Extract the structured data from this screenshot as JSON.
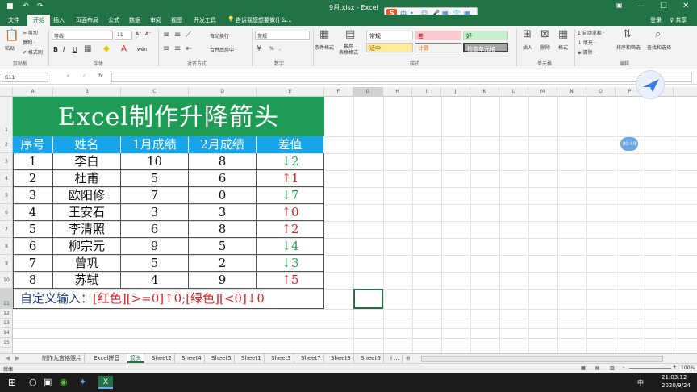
{
  "window": {
    "title": "9月.xlsx - Excel",
    "min": "—",
    "max": "☐",
    "close": "✕",
    "restore": "▣"
  },
  "quick_access": {
    "save": "■",
    "undo": "↶",
    "redo": "↷"
  },
  "ime": {
    "logo": "S",
    "items": [
      "中",
      "•,",
      "☺",
      "🎤",
      "▦",
      "👕",
      "▦"
    ]
  },
  "tabs": [
    "文件",
    "开始",
    "插入",
    "页面布局",
    "公式",
    "数据",
    "审阅",
    "视图",
    "开发工具"
  ],
  "active_tab": "开始",
  "tellme": "告诉我您想要做什么...",
  "account": {
    "login": "登录",
    "share": "♀ 共享"
  },
  "ribbon": {
    "clipboard": {
      "paste": "粘贴",
      "cut": "✂ 剪切",
      "copy": "复制 ·",
      "painter": "✐ 格式刷",
      "group": "剪贴板"
    },
    "font": {
      "name": "等线",
      "size": "11",
      "bold": "B",
      "italic": "I",
      "underline": "U",
      "grow": "A⁺",
      "shrink": "A⁻",
      "wen": "wén",
      "group": "字体"
    },
    "align": {
      "wrap": "自动换行",
      "merge": "合并后居中 ·",
      "group": "对齐方式"
    },
    "number": {
      "format": "常规",
      "pct": "%",
      "comma": ",",
      "group": "数字"
    },
    "styles": {
      "cond": "条件格式",
      "table": "套用\n表格格式",
      "normal": "常规",
      "bad": "差",
      "good": "好",
      "neutral": "适中",
      "calc": "计算",
      "check": "检查单元格",
      "group": "样式"
    },
    "cells": {
      "insert": "插入",
      "delete": "删除",
      "format": "格式",
      "group": "单元格"
    },
    "editing": {
      "autosum": "Σ 自动求和 ·",
      "fill": "↓ 填充 ·",
      "clear": "◈ 清除 ·",
      "sort": "排序和筛选",
      "find": "查找和选择",
      "group": "编辑"
    }
  },
  "formula_bar": {
    "name_box": "G11",
    "cancel": "✕",
    "enter": "✓",
    "fx": "fx",
    "value": ""
  },
  "columns": [
    "A",
    "B",
    "C",
    "D",
    "E",
    "F",
    "G",
    "H",
    "I",
    "J",
    "K",
    "L",
    "M",
    "N",
    "O",
    "P",
    "Q"
  ],
  "rows": [
    "1",
    "2",
    "3",
    "4",
    "5",
    "6",
    "7",
    "8",
    "9",
    "10",
    "11",
    "12",
    "13",
    "14",
    "15"
  ],
  "sheet": {
    "title": "Excel制作升降箭头",
    "headers": [
      "序号",
      "姓名",
      "1月成绩",
      "2月成绩",
      "差值"
    ],
    "records": [
      {
        "no": "1",
        "name": "李白",
        "jan": "10",
        "feb": "8",
        "diff_arrow": "↓",
        "diff": "2",
        "dir": "down"
      },
      {
        "no": "2",
        "name": "杜甫",
        "jan": "5",
        "feb": "6",
        "diff_arrow": "↑",
        "diff": "1",
        "dir": "up"
      },
      {
        "no": "3",
        "name": "欧阳修",
        "jan": "7",
        "feb": "0",
        "diff_arrow": "↓",
        "diff": "7",
        "dir": "down"
      },
      {
        "no": "4",
        "name": "王安石",
        "jan": "3",
        "feb": "3",
        "diff_arrow": "↑",
        "diff": "0",
        "dir": "up"
      },
      {
        "no": "5",
        "name": "李清照",
        "jan": "6",
        "feb": "8",
        "diff_arrow": "↑",
        "diff": "2",
        "dir": "up"
      },
      {
        "no": "6",
        "name": "柳宗元",
        "jan": "9",
        "feb": "5",
        "diff_arrow": "↓",
        "diff": "4",
        "dir": "down"
      },
      {
        "no": "7",
        "name": "曾巩",
        "jan": "5",
        "feb": "2",
        "diff_arrow": "↓",
        "diff": "3",
        "dir": "down"
      },
      {
        "no": "8",
        "name": "苏轼",
        "jan": "4",
        "feb": "9",
        "diff_arrow": "↑",
        "diff": "5",
        "dir": "up"
      }
    ],
    "note_prefix": "自定义输入：",
    "note_format": "[红色][>=0]↑0;[绿色][<0]↓0"
  },
  "sheet_tabs": [
    "制作九宫格照片",
    "Excel拼音",
    "箭头",
    "Sheet2",
    "Sheet4",
    "Sheet5",
    "Sheet1",
    "Sheet3",
    "Sheet7",
    "Sheet8",
    "Sheet6",
    "i ..."
  ],
  "active_sheet": "箭头",
  "status": {
    "ready": "就绪",
    "zoom": "100%",
    "minus": "-",
    "plus": "+"
  },
  "overlay": {
    "timer": "00:49"
  },
  "taskbar": {
    "time": "21:03:12",
    "date": "2020/9/24",
    "ime": "中",
    "apps": [
      "⊞",
      "○",
      "▣",
      "◉",
      "✦",
      "X"
    ]
  },
  "colors": {
    "excel_green": "#217346",
    "title_fill": "#1e9b55",
    "header_fill": "#17a4e8",
    "up": "#e02020",
    "down": "#18a84a",
    "note_blue": "#1f3d8a"
  }
}
